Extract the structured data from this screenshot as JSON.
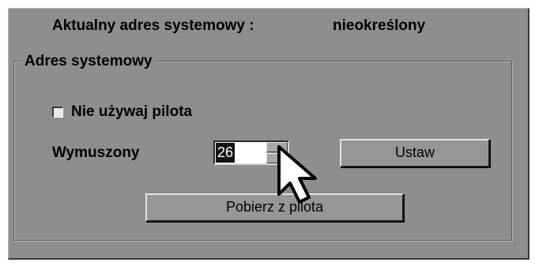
{
  "current_address": {
    "label": "Aktualny adres systemowy :",
    "value": "nieokreślony"
  },
  "system_address_group": {
    "title": "Adres systemowy",
    "no_remote_checkbox": {
      "label": "Nie używaj pilota",
      "checked": false
    },
    "forced": {
      "label": "Wymuszony",
      "value": "26"
    },
    "set_button": "Ustaw",
    "fetch_button": "Pobierz z pilota"
  },
  "icons": {
    "cursor": "mouse-pointer-icon"
  },
  "colors": {
    "panel_bg": "#8e8e8e",
    "field_bg": "#ffffff",
    "selection_bg": "#111111"
  }
}
